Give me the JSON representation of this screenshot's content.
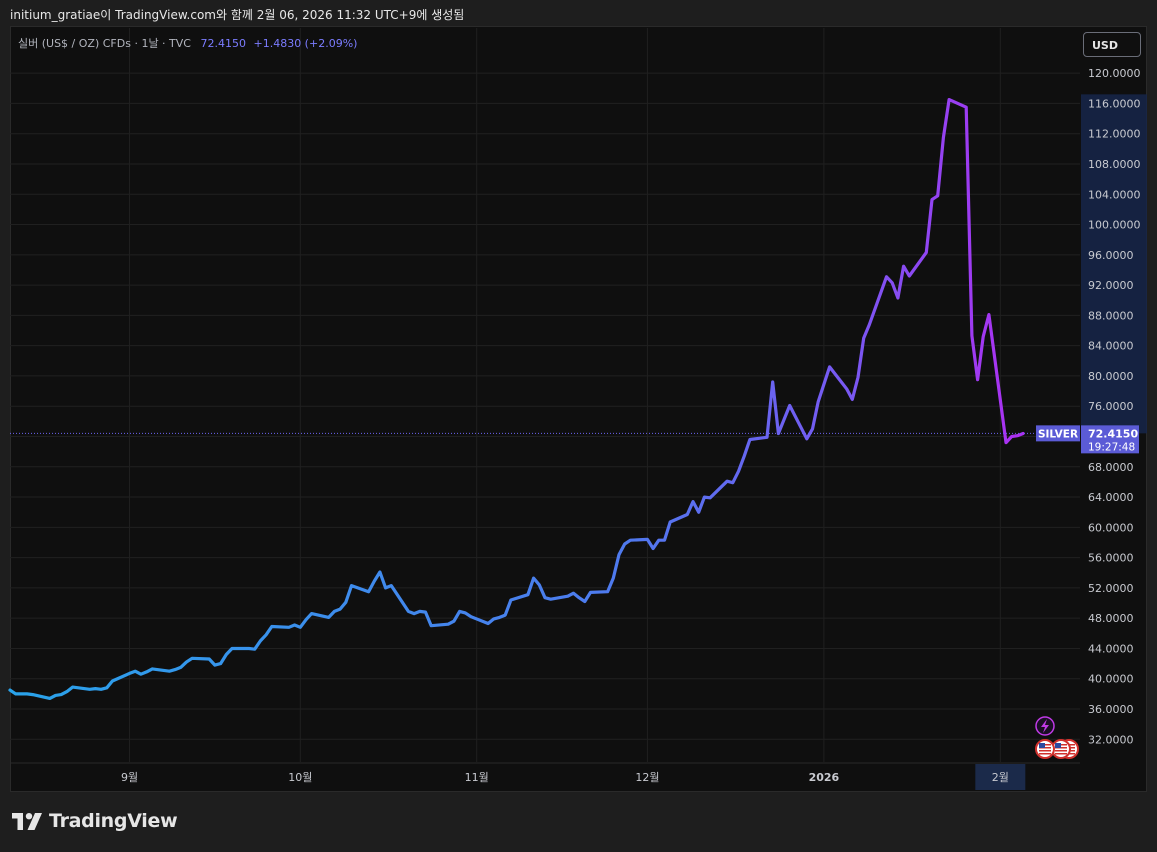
{
  "header": {
    "caption": "initium_gratiae이 TradingView.com와 함께 2월 06, 2026 11:32 UTC+9에 생성됨"
  },
  "legend": {
    "symbol_text": "실버 (US$ / OZ) CFDs · 1날 · TVC",
    "price": "72.4150",
    "change": "+1.4830 (+2.09%)"
  },
  "currency_button": "USD",
  "footer": {
    "brand": "TradingView"
  },
  "colors": {
    "start": "#29a3ea",
    "mid": "#6a5cf0",
    "end": "#b32bf2",
    "panel": "#0f0f0f",
    "price_tag": "#5b5bd6",
    "axis_highlight": "#1b2a4a"
  },
  "chart_data": {
    "type": "line",
    "title": "실버 (US$ / OZ) CFDs · 1날 · TVC",
    "series_label": "SILVER",
    "last_value": 72.415,
    "last_value_label": "72.4150",
    "countdown": "19:27:48",
    "ylim": [
      29,
      122
    ],
    "y_ticks": [
      "32.0000",
      "36.0000",
      "40.0000",
      "44.0000",
      "48.0000",
      "52.0000",
      "56.0000",
      "60.0000",
      "64.0000",
      "68.0000",
      "72.0000",
      "76.0000",
      "80.0000",
      "84.0000",
      "88.0000",
      "92.0000",
      "96.0000",
      "100.0000",
      "104.0000",
      "108.0000",
      "112.0000",
      "116.0000",
      "120.0000"
    ],
    "x_ticks": [
      {
        "label": "9월",
        "date": "2025-09-01"
      },
      {
        "label": "10월",
        "date": "2025-10-01"
      },
      {
        "label": "11월",
        "date": "2025-11-01"
      },
      {
        "label": "12월",
        "date": "2025-12-01"
      },
      {
        "label": "2026",
        "date": "2026-01-01",
        "bold": true
      },
      {
        "label": "2월",
        "date": "2026-02-01",
        "highlight": true
      }
    ],
    "xlim": [
      "2025-08-11",
      "2026-02-15"
    ],
    "points": [
      [
        "2025-08-11",
        38.5
      ],
      [
        "2025-08-12",
        38.0
      ],
      [
        "2025-08-13",
        38.0
      ],
      [
        "2025-08-14",
        38.0
      ],
      [
        "2025-08-15",
        37.9
      ],
      [
        "2025-08-18",
        37.4
      ],
      [
        "2025-08-19",
        37.8
      ],
      [
        "2025-08-20",
        37.9
      ],
      [
        "2025-08-21",
        38.3
      ],
      [
        "2025-08-22",
        38.9
      ],
      [
        "2025-08-25",
        38.6
      ],
      [
        "2025-08-26",
        38.7
      ],
      [
        "2025-08-27",
        38.6
      ],
      [
        "2025-08-28",
        38.8
      ],
      [
        "2025-08-29",
        39.7
      ],
      [
        "2025-09-01",
        40.7
      ],
      [
        "2025-09-02",
        41.0
      ],
      [
        "2025-09-03",
        40.6
      ],
      [
        "2025-09-04",
        40.9
      ],
      [
        "2025-09-05",
        41.3
      ],
      [
        "2025-09-08",
        41.0
      ],
      [
        "2025-09-09",
        41.2
      ],
      [
        "2025-09-10",
        41.5
      ],
      [
        "2025-09-11",
        42.2
      ],
      [
        "2025-09-12",
        42.7
      ],
      [
        "2025-09-15",
        42.6
      ],
      [
        "2025-09-16",
        41.8
      ],
      [
        "2025-09-17",
        42.0
      ],
      [
        "2025-09-18",
        43.2
      ],
      [
        "2025-09-19",
        44.0
      ],
      [
        "2025-09-22",
        44.0
      ],
      [
        "2025-09-23",
        43.9
      ],
      [
        "2025-09-24",
        45.0
      ],
      [
        "2025-09-25",
        45.8
      ],
      [
        "2025-09-26",
        46.9
      ],
      [
        "2025-09-29",
        46.8
      ],
      [
        "2025-09-30",
        47.1
      ],
      [
        "2025-10-01",
        46.8
      ],
      [
        "2025-10-02",
        47.8
      ],
      [
        "2025-10-03",
        48.6
      ],
      [
        "2025-10-06",
        48.1
      ],
      [
        "2025-10-07",
        48.9
      ],
      [
        "2025-10-08",
        49.2
      ],
      [
        "2025-10-09",
        50.1
      ],
      [
        "2025-10-10",
        52.3
      ],
      [
        "2025-10-13",
        51.5
      ],
      [
        "2025-10-14",
        52.9
      ],
      [
        "2025-10-15",
        54.1
      ],
      [
        "2025-10-16",
        52.0
      ],
      [
        "2025-10-17",
        52.3
      ],
      [
        "2025-10-20",
        48.9
      ],
      [
        "2025-10-21",
        48.6
      ],
      [
        "2025-10-22",
        48.9
      ],
      [
        "2025-10-23",
        48.8
      ],
      [
        "2025-10-24",
        47.0
      ],
      [
        "2025-10-27",
        47.2
      ],
      [
        "2025-10-28",
        47.6
      ],
      [
        "2025-10-29",
        48.9
      ],
      [
        "2025-10-30",
        48.7
      ],
      [
        "2025-10-31",
        48.2
      ],
      [
        "2025-11-03",
        47.3
      ],
      [
        "2025-11-04",
        47.9
      ],
      [
        "2025-11-05",
        48.1
      ],
      [
        "2025-11-06",
        48.4
      ],
      [
        "2025-11-07",
        50.4
      ],
      [
        "2025-11-10",
        51.1
      ],
      [
        "2025-11-11",
        53.3
      ],
      [
        "2025-11-12",
        52.4
      ],
      [
        "2025-11-13",
        50.7
      ],
      [
        "2025-11-14",
        50.5
      ],
      [
        "2025-11-17",
        50.9
      ],
      [
        "2025-11-18",
        51.3
      ],
      [
        "2025-11-19",
        50.7
      ],
      [
        "2025-11-20",
        50.2
      ],
      [
        "2025-11-21",
        51.4
      ],
      [
        "2025-11-24",
        51.5
      ],
      [
        "2025-11-25",
        53.3
      ],
      [
        "2025-11-26",
        56.4
      ],
      [
        "2025-11-27",
        57.8
      ],
      [
        "2025-11-28",
        58.3
      ],
      [
        "2025-12-01",
        58.4
      ],
      [
        "2025-12-02",
        57.2
      ],
      [
        "2025-12-03",
        58.3
      ],
      [
        "2025-12-04",
        58.3
      ],
      [
        "2025-12-05",
        60.7
      ],
      [
        "2025-12-08",
        61.7
      ],
      [
        "2025-12-09",
        63.4
      ],
      [
        "2025-12-10",
        62.0
      ],
      [
        "2025-12-11",
        64.0
      ],
      [
        "2025-12-12",
        63.9
      ],
      [
        "2025-12-15",
        66.1
      ],
      [
        "2025-12-16",
        65.9
      ],
      [
        "2025-12-17",
        67.4
      ],
      [
        "2025-12-18",
        69.4
      ],
      [
        "2025-12-19",
        71.6
      ],
      [
        "2025-12-22",
        71.9
      ],
      [
        "2025-12-23",
        79.2
      ],
      [
        "2025-12-24",
        72.4
      ],
      [
        "2025-12-26",
        76.1
      ],
      [
        "2025-12-29",
        71.7
      ],
      [
        "2025-12-30",
        73.0
      ],
      [
        "2025-12-31",
        76.6
      ],
      [
        "2026-01-02",
        81.2
      ],
      [
        "2026-01-05",
        78.3
      ],
      [
        "2026-01-06",
        76.9
      ],
      [
        "2026-01-07",
        79.8
      ],
      [
        "2026-01-08",
        85.0
      ],
      [
        "2026-01-09",
        86.8
      ],
      [
        "2026-01-12",
        93.1
      ],
      [
        "2026-01-13",
        92.3
      ],
      [
        "2026-01-14",
        90.3
      ],
      [
        "2026-01-15",
        94.5
      ],
      [
        "2026-01-16",
        93.2
      ],
      [
        "2026-01-19",
        96.3
      ],
      [
        "2026-01-20",
        103.3
      ],
      [
        "2026-01-21",
        103.8
      ],
      [
        "2026-01-22",
        111.5
      ],
      [
        "2026-01-23",
        116.5
      ],
      [
        "2026-01-26",
        115.5
      ],
      [
        "2026-01-27",
        85.3
      ],
      [
        "2026-01-28",
        79.5
      ],
      [
        "2026-01-29",
        85.2
      ],
      [
        "2026-01-30",
        88.1
      ],
      [
        "2026-02-02",
        71.2
      ],
      [
        "2026-02-03",
        72.0
      ],
      [
        "2026-02-04",
        72.1
      ],
      [
        "2026-02-05",
        72.4
      ]
    ]
  }
}
